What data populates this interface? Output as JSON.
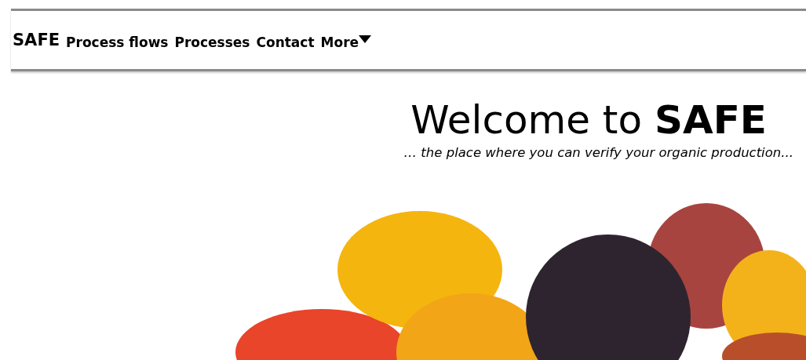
{
  "navbar": {
    "brand": "SAFE",
    "items": [
      {
        "label": "Process flows",
        "kind": "link"
      },
      {
        "label": "Processes",
        "kind": "link"
      },
      {
        "label": "Contact",
        "kind": "link"
      },
      {
        "label": "More",
        "kind": "dropdown"
      }
    ]
  },
  "hero": {
    "heading": "Welcome to **SAFE**",
    "tagline": "… the place where you can verify your organic production..."
  }
}
